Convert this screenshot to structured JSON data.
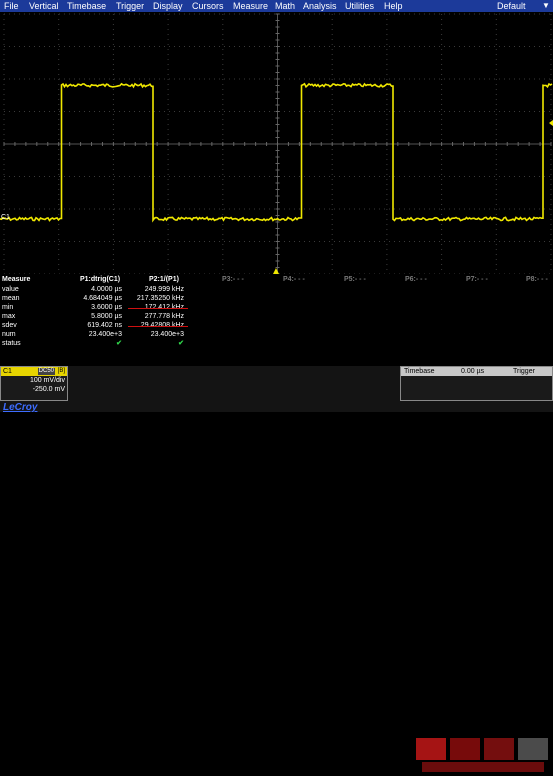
{
  "menu": [
    "File",
    "Vertical",
    "Timebase",
    "Trigger",
    "Display",
    "Cursors",
    "Measure",
    "Math",
    "Analysis",
    "Utilities",
    "Help"
  ],
  "preset": "Default",
  "trace": {
    "color": "#f0e800",
    "channel_label": "C1",
    "periods_per_screen": 2.3,
    "duty_cycle": 0.38,
    "high_level_fraction": 0.28,
    "low_level_fraction": 0.79
  },
  "measure": {
    "header_label": "Measure",
    "columns": [
      "P1:dtrig(C1)",
      "P2:1/(P1)",
      "P3:- - -",
      "P4:- - -",
      "P5:- - -",
      "P6:- - -",
      "P7:- - -",
      "P8:- - -"
    ],
    "rows": [
      {
        "label": "value",
        "p1": "4.0000 µs",
        "p2": "249.999 kHz"
      },
      {
        "label": "mean",
        "p1": "4.684049 µs",
        "p2": "217.35250 kHz"
      },
      {
        "label": "min",
        "p1": "3.6000 µs",
        "p2": "172.412 kHz"
      },
      {
        "label": "max",
        "p1": "5.8000 µs",
        "p2": "277.778 kHz"
      },
      {
        "label": "sdev",
        "p1": "619.402 ns",
        "p2": "29.42808 kHz"
      },
      {
        "label": "num",
        "p1": "23.400e+3",
        "p2": "23.400e+3"
      },
      {
        "label": "status",
        "p1": "✔",
        "p2": "✔"
      }
    ]
  },
  "channel_box": {
    "label": "C1",
    "tag": "DC50",
    "tag2": "[B]",
    "volts_div": "100 mV/div",
    "offset": "-250.0 mV"
  },
  "brand": "LeCroy",
  "timebase_box": {
    "label": "Timebase",
    "value": "0.00 µs",
    "trigger_label": "Trigger"
  },
  "colors": {
    "menubar": "#1c3a9a",
    "trace": "#f0e800",
    "grid": "#3a3a3a",
    "underline": "#d01010",
    "status_ok": "#2fd44a"
  }
}
